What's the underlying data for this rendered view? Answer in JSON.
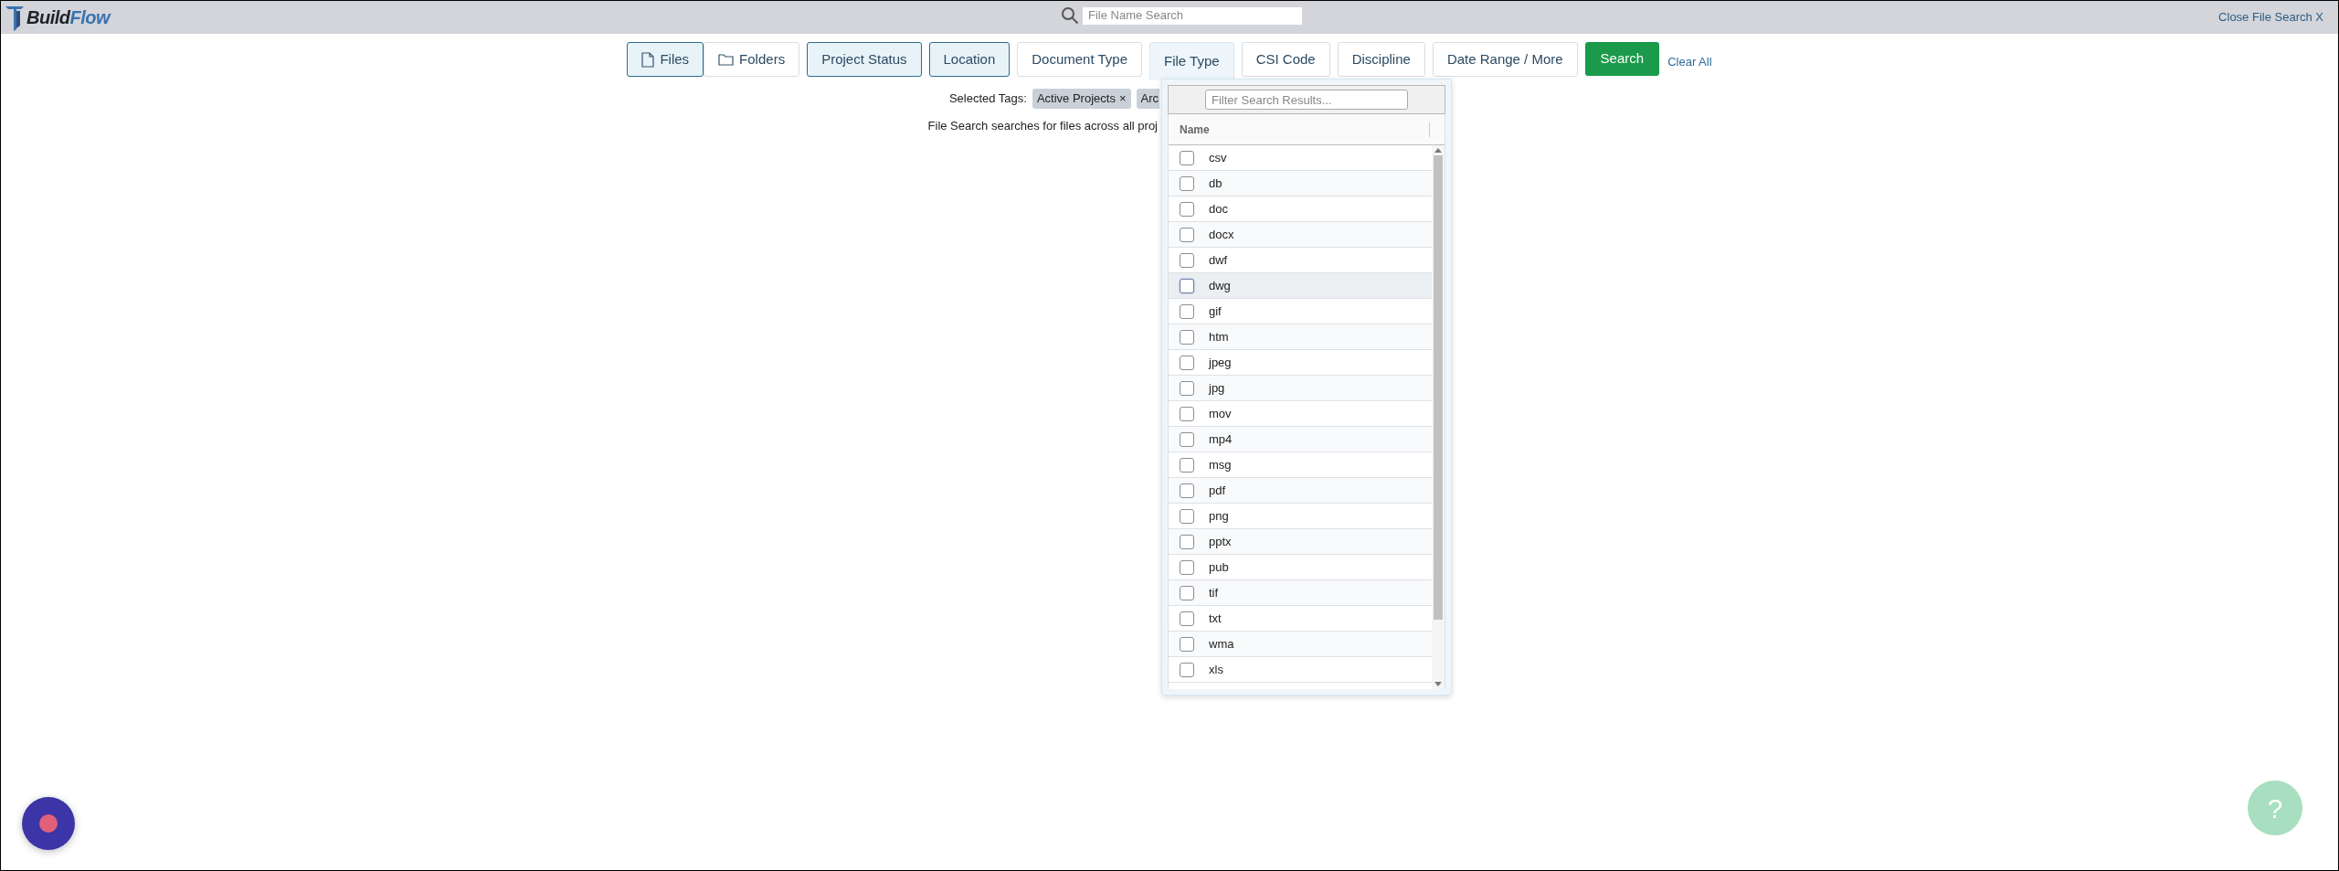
{
  "header": {
    "logo": {
      "dark": "Build",
      "accent": "Flow"
    },
    "search": {
      "placeholder": "File Name Search"
    },
    "close_link": "Close File Search X"
  },
  "filters": [
    {
      "label": "Files",
      "kind": "segment",
      "selected": true,
      "open": false
    },
    {
      "label": "Folders",
      "kind": "segment",
      "selected": false,
      "open": false
    },
    {
      "label": "Project Status",
      "kind": "button",
      "selected": true,
      "open": false
    },
    {
      "label": "Location",
      "kind": "button",
      "selected": true,
      "open": false
    },
    {
      "label": "Document Type",
      "kind": "button",
      "selected": false,
      "open": false
    },
    {
      "label": "File Type",
      "kind": "button",
      "selected": false,
      "open": true
    },
    {
      "label": "CSI Code",
      "kind": "button",
      "selected": false,
      "open": false
    },
    {
      "label": "Discipline",
      "kind": "button",
      "selected": false,
      "open": false
    },
    {
      "label": "Date Range / More",
      "kind": "button",
      "selected": false,
      "open": false
    }
  ],
  "search_button": "Search",
  "clear_all": "Clear All",
  "selected_tags": {
    "label": "Selected Tags:",
    "tags": [
      {
        "text": "Active Projects",
        "remove": "×"
      },
      {
        "text": "Arc"
      }
    ]
  },
  "info_text": "File Search searches for files across all proj",
  "dropdown": {
    "filter": {
      "placeholder": "Filter Search Results..."
    },
    "column": "Name",
    "items": [
      {
        "label": "csv",
        "checked": false,
        "hovered": false
      },
      {
        "label": "db",
        "checked": false,
        "hovered": false
      },
      {
        "label": "doc",
        "checked": false,
        "hovered": false
      },
      {
        "label": "docx",
        "checked": false,
        "hovered": false
      },
      {
        "label": "dwf",
        "checked": false,
        "hovered": false
      },
      {
        "label": "dwg",
        "checked": false,
        "hovered": true
      },
      {
        "label": "gif",
        "checked": false,
        "hovered": false
      },
      {
        "label": "htm",
        "checked": false,
        "hovered": false
      },
      {
        "label": "jpeg",
        "checked": false,
        "hovered": false
      },
      {
        "label": "jpg",
        "checked": false,
        "hovered": false
      },
      {
        "label": "mov",
        "checked": false,
        "hovered": false
      },
      {
        "label": "mp4",
        "checked": false,
        "hovered": false
      },
      {
        "label": "msg",
        "checked": false,
        "hovered": false
      },
      {
        "label": "pdf",
        "checked": false,
        "hovered": false
      },
      {
        "label": "png",
        "checked": false,
        "hovered": false
      },
      {
        "label": "pptx",
        "checked": false,
        "hovered": false
      },
      {
        "label": "pub",
        "checked": false,
        "hovered": false
      },
      {
        "label": "tif",
        "checked": false,
        "hovered": false
      },
      {
        "label": "txt",
        "checked": false,
        "hovered": false
      },
      {
        "label": "wma",
        "checked": false,
        "hovered": false
      },
      {
        "label": "xls",
        "checked": false,
        "hovered": false
      }
    ]
  },
  "help_button": "?"
}
